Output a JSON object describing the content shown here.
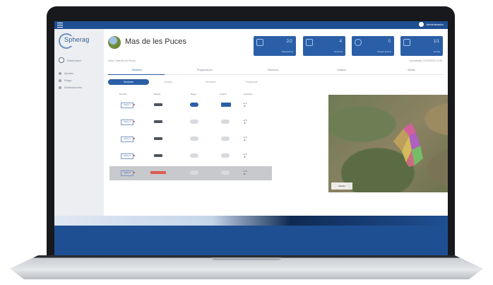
{
  "topbar": {
    "user_name": "Administrador"
  },
  "sidebar": {
    "logo": "Spherag",
    "items": [
      {
        "label": "Dashboard"
      },
      {
        "label": "Ajustes"
      },
      {
        "label": "Riego"
      },
      {
        "label": "Notificaciones"
      }
    ]
  },
  "header": {
    "title": "Mas de les Puces",
    "breadcrumb": "Inicio / Mas de les Puces",
    "last_update": "Actualizado 21/03/2020 11:58",
    "stats": [
      {
        "value": "2/2",
        "label": "Dispositivos"
      },
      {
        "value": "4",
        "label": "Sectores"
      },
      {
        "value": "0",
        "label": "Riegos activos"
      },
      {
        "value": "1/1",
        "label": "Alertas"
      }
    ]
  },
  "tabs": [
    "Sectores",
    "Programación",
    "Históricos",
    "Gráficos",
    "Alertas"
  ],
  "subtabs": [
    "Sectores",
    "Grupos",
    "Sensores",
    "Programas"
  ],
  "table": {
    "headers": [
      "Nombre",
      "Estado",
      "Riego",
      "Control",
      "Acciones"
    ],
    "rows": [
      {
        "name": "Sector 1",
        "state": "OK",
        "riego": true,
        "control": true
      },
      {
        "name": "Sector 2",
        "state": "OK",
        "riego": false,
        "control": false
      },
      {
        "name": "Sector 3",
        "state": "OK",
        "riego": false,
        "control": false
      },
      {
        "name": "Sector 4",
        "state": "OK",
        "riego": false,
        "control": false
      },
      {
        "name": "Sector 5",
        "state": "Error",
        "riego": false,
        "control": false,
        "selected": true
      }
    ]
  },
  "map": {
    "layer_label": "Satélite",
    "zoom_in": "+",
    "zoom_out": "−"
  },
  "colors": {
    "primary": "#1f4f93",
    "accent": "#2a5fa8",
    "alert": "#de5a4f"
  }
}
